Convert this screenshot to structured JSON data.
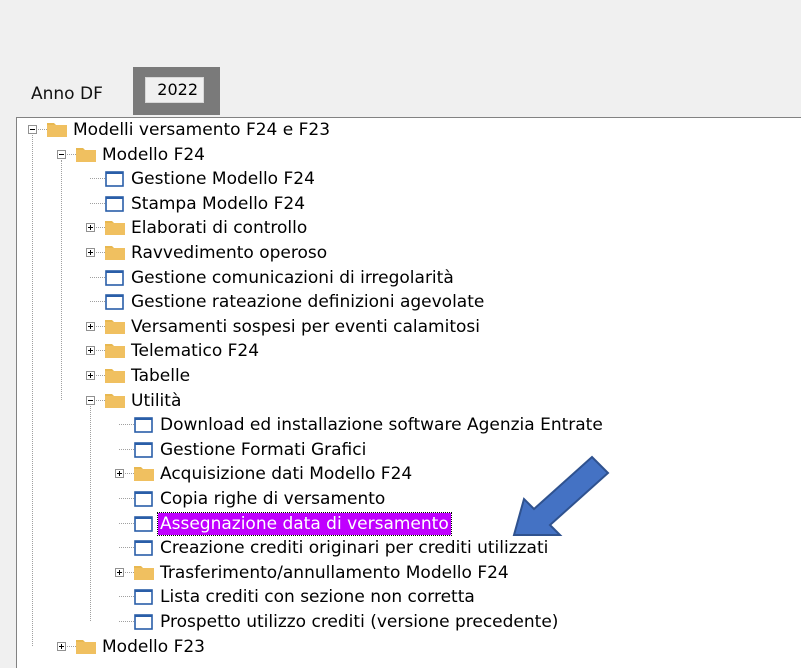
{
  "year": {
    "label": "Anno DF",
    "value": "2022"
  },
  "tree": {
    "nodes": [
      "Modelli versamento F24 e F23",
      "Modello F24",
      "Gestione Modello F24",
      "Stampa Modello F24",
      "Elaborati di controllo",
      "Ravvedimento operoso",
      "Gestione comunicazioni di irregolarità",
      "Gestione rateazione definizioni agevolate",
      "Versamenti sospesi per eventi calamitosi",
      "Telematico F24",
      "Tabelle",
      "Utilità",
      "Download ed installazione software Agenzia Entrate",
      "Gestione Formati Grafici",
      "Acquisizione dati Modello F24",
      "Copia righe di versamento",
      "Assegnazione data di versamento",
      "Creazione crediti originari per crediti utilizzati",
      "Trasferimento/annullamento Modello F24",
      "Lista crediti con sezione non corretta",
      "Prospetto utilizzo crediti (versione precedente)",
      "Modello F23"
    ],
    "selected_index": 16
  },
  "colors": {
    "folder": "#f0c060",
    "doc_border": "#2a5ea8",
    "selection": "#c000ff",
    "arrow": "#4472c4"
  }
}
